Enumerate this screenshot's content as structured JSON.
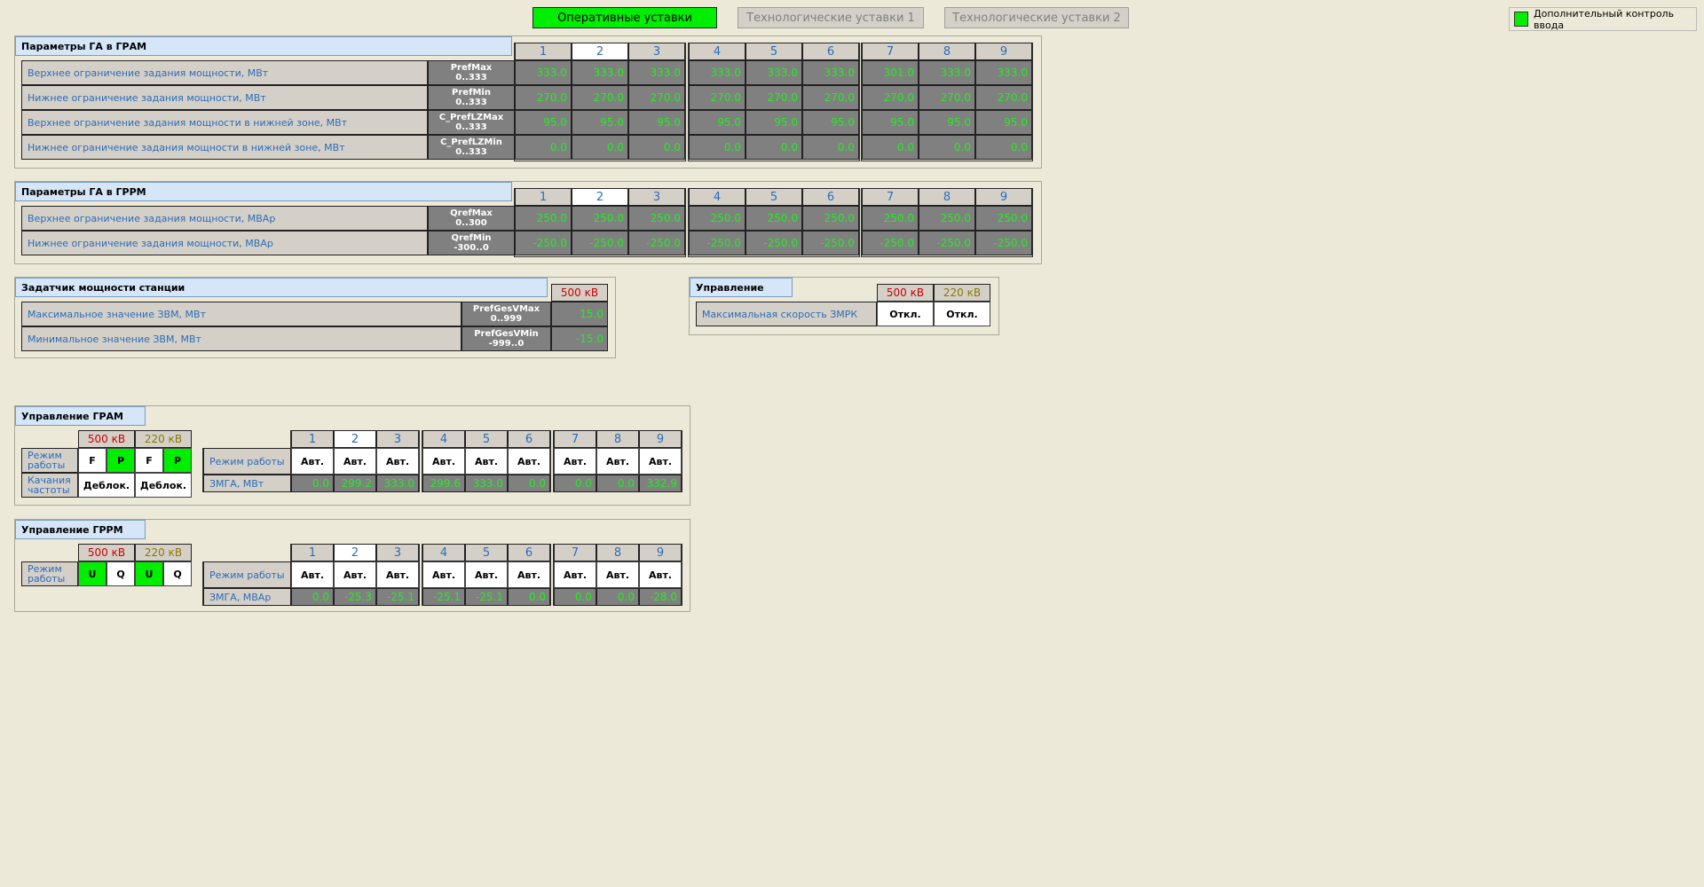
{
  "nav": {
    "tab_operative": "Оперативные уставки",
    "tab_tech1": "Технологические уставки 1",
    "tab_tech2": "Технологические уставки 2",
    "legend": "Дополнительный контроль ввода"
  },
  "colors": {
    "active": "#00ee00",
    "value_green": "#22ee22",
    "label_blue": "#2b6cb8",
    "kv500": "#cc0000",
    "kv220": "#8a7a00"
  },
  "units": [
    "1",
    "2",
    "3",
    "4",
    "5",
    "6",
    "7",
    "8",
    "9"
  ],
  "gram_params": {
    "title": "Параметры ГА в ГРАМ",
    "rows": [
      {
        "label": "Верхнее ограничение задания мощности, МВт",
        "code1": "PrefMax",
        "code2": "0..333",
        "values": [
          "333.0",
          "333.0",
          "333.0",
          "333.0",
          "333.0",
          "333.0",
          "301.0",
          "333.0",
          "333.0"
        ]
      },
      {
        "label": "Нижнее ограничение задания мощности, МВт",
        "code1": "PrefMin",
        "code2": "0..333",
        "values": [
          "270.0",
          "270.0",
          "270.0",
          "270.0",
          "270.0",
          "270.0",
          "270.0",
          "270.0",
          "270.0"
        ]
      },
      {
        "label": "Верхнее ограничение задания мощности в нижней зоне, МВт",
        "code1": "C_PrefLZMax",
        "code2": "0..333",
        "values": [
          "95.0",
          "95.0",
          "95.0",
          "95.0",
          "95.0",
          "95.0",
          "95.0",
          "95.0",
          "95.0"
        ]
      },
      {
        "label": "Нижнее ограничение задания мощности в нижней зоне, МВт",
        "code1": "C_PrefLZMin",
        "code2": "0..333",
        "values": [
          "0.0",
          "0.0",
          "0.0",
          "0.0",
          "0.0",
          "0.0",
          "0.0",
          "0.0",
          "0.0"
        ]
      }
    ]
  },
  "grpm_params": {
    "title": "Параметры ГА в ГРРМ",
    "rows": [
      {
        "label": "Верхнее ограничение задания мощности, МВАр",
        "code1": "QrefMax",
        "code2": "0..300",
        "values": [
          "250.0",
          "250.0",
          "250.0",
          "250.0",
          "250.0",
          "250.0",
          "250.0",
          "250.0",
          "250.0"
        ]
      },
      {
        "label": "Нижнее ограничение задания мощности, МВАр",
        "code1": "QrefMin",
        "code2": "-300..0",
        "values": [
          "-250.0",
          "-250.0",
          "-250.0",
          "-250.0",
          "-250.0",
          "-250.0",
          "-250.0",
          "-250.0",
          "-250.0"
        ]
      }
    ]
  },
  "station": {
    "title": "Задатчик мощности станции",
    "kv500": "500 кВ",
    "rows": [
      {
        "label": "Максимальное значение ЗВМ, МВт",
        "code1": "PrefGesVMax",
        "code2": "0..999",
        "value": "15.0"
      },
      {
        "label": "Минимальное значение ЗВМ, МВт",
        "code1": "PrefGesVMin",
        "code2": "-999..0",
        "value": "-15.0"
      }
    ]
  },
  "control": {
    "title": "Управление",
    "kv500": "500 кВ",
    "kv220": "220 кВ",
    "row_label": "Максимальная скорость ЗМРК",
    "btn500": "Откл.",
    "btn220": "Откл."
  },
  "gram_ctrl": {
    "title": "Управление ГРАМ",
    "kv500": "500 кВ",
    "kv220": "220 кВ",
    "mode_label": "Режим работы",
    "swing_label": "Качания частоты",
    "mode500": [
      "F",
      "P"
    ],
    "mode220": [
      "F",
      "P"
    ],
    "unblock500": "Деблок.",
    "unblock220": "Деблок.",
    "row_mode": "Режим работы",
    "row_zmga": "ЗМГА, МВт",
    "modes": [
      "Авт.",
      "Авт.",
      "Авт.",
      "Авт.",
      "Авт.",
      "Авт.",
      "Авт.",
      "Авт.",
      "Авт."
    ],
    "zmga": [
      "0.0",
      "299.2",
      "333.0",
      "299.6",
      "333.0",
      "0.0",
      "0.0",
      "0.0",
      "332.9"
    ]
  },
  "grpm_ctrl": {
    "title": "Управление ГРРМ",
    "kv500": "500 кВ",
    "kv220": "220 кВ",
    "mode_label": "Режим работы",
    "mode500": [
      "U",
      "Q"
    ],
    "mode220": [
      "U",
      "Q"
    ],
    "row_mode": "Режим работы",
    "row_zmga": "ЗМГА, МВАр",
    "modes": [
      "Авт.",
      "Авт.",
      "Авт.",
      "Авт.",
      "Авт.",
      "Авт.",
      "Авт.",
      "Авт.",
      "Авт."
    ],
    "zmga": [
      "0.0",
      "-25.3",
      "-25.1",
      "-25.1",
      "-25.1",
      "0.0",
      "0.0",
      "0.0",
      "-28.0"
    ]
  }
}
